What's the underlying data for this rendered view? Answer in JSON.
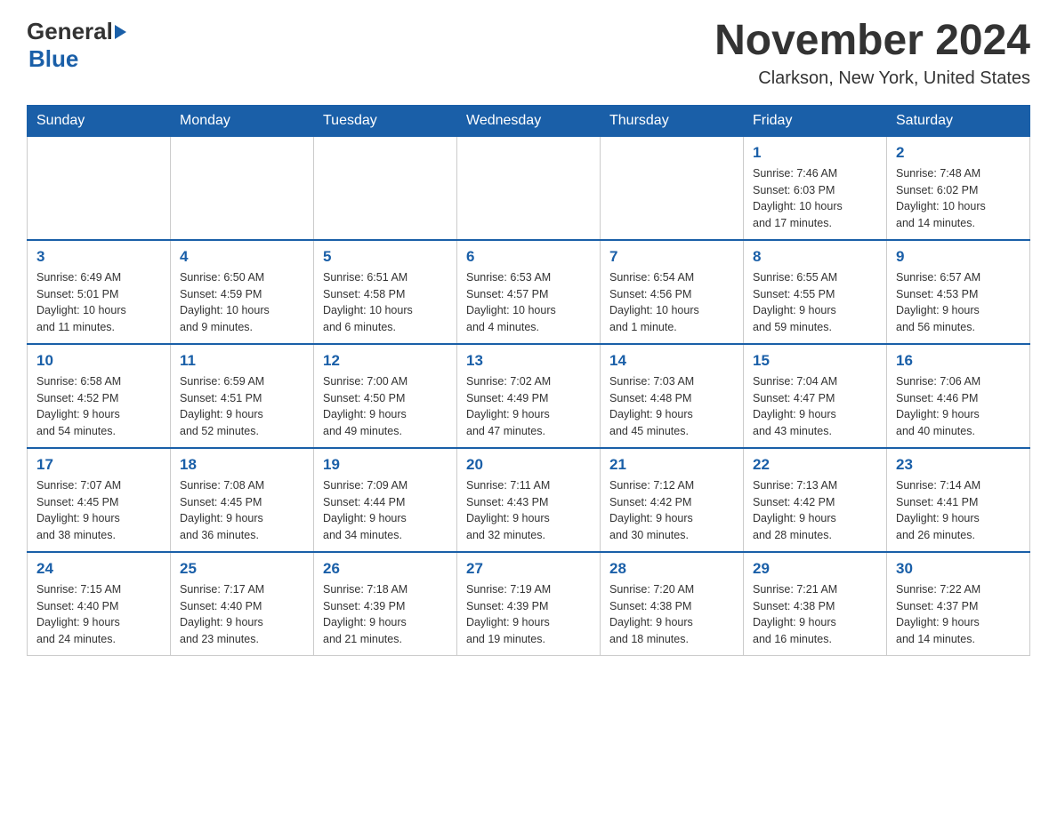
{
  "header": {
    "logo_general": "General",
    "logo_blue": "Blue",
    "title": "November 2024",
    "subtitle": "Clarkson, New York, United States"
  },
  "weekdays": [
    "Sunday",
    "Monday",
    "Tuesday",
    "Wednesday",
    "Thursday",
    "Friday",
    "Saturday"
  ],
  "rows": [
    {
      "cells": [
        {
          "day": "",
          "info": ""
        },
        {
          "day": "",
          "info": ""
        },
        {
          "day": "",
          "info": ""
        },
        {
          "day": "",
          "info": ""
        },
        {
          "day": "",
          "info": ""
        },
        {
          "day": "1",
          "info": "Sunrise: 7:46 AM\nSunset: 6:03 PM\nDaylight: 10 hours\nand 17 minutes."
        },
        {
          "day": "2",
          "info": "Sunrise: 7:48 AM\nSunset: 6:02 PM\nDaylight: 10 hours\nand 14 minutes."
        }
      ]
    },
    {
      "cells": [
        {
          "day": "3",
          "info": "Sunrise: 6:49 AM\nSunset: 5:01 PM\nDaylight: 10 hours\nand 11 minutes."
        },
        {
          "day": "4",
          "info": "Sunrise: 6:50 AM\nSunset: 4:59 PM\nDaylight: 10 hours\nand 9 minutes."
        },
        {
          "day": "5",
          "info": "Sunrise: 6:51 AM\nSunset: 4:58 PM\nDaylight: 10 hours\nand 6 minutes."
        },
        {
          "day": "6",
          "info": "Sunrise: 6:53 AM\nSunset: 4:57 PM\nDaylight: 10 hours\nand 4 minutes."
        },
        {
          "day": "7",
          "info": "Sunrise: 6:54 AM\nSunset: 4:56 PM\nDaylight: 10 hours\nand 1 minute."
        },
        {
          "day": "8",
          "info": "Sunrise: 6:55 AM\nSunset: 4:55 PM\nDaylight: 9 hours\nand 59 minutes."
        },
        {
          "day": "9",
          "info": "Sunrise: 6:57 AM\nSunset: 4:53 PM\nDaylight: 9 hours\nand 56 minutes."
        }
      ]
    },
    {
      "cells": [
        {
          "day": "10",
          "info": "Sunrise: 6:58 AM\nSunset: 4:52 PM\nDaylight: 9 hours\nand 54 minutes."
        },
        {
          "day": "11",
          "info": "Sunrise: 6:59 AM\nSunset: 4:51 PM\nDaylight: 9 hours\nand 52 minutes."
        },
        {
          "day": "12",
          "info": "Sunrise: 7:00 AM\nSunset: 4:50 PM\nDaylight: 9 hours\nand 49 minutes."
        },
        {
          "day": "13",
          "info": "Sunrise: 7:02 AM\nSunset: 4:49 PM\nDaylight: 9 hours\nand 47 minutes."
        },
        {
          "day": "14",
          "info": "Sunrise: 7:03 AM\nSunset: 4:48 PM\nDaylight: 9 hours\nand 45 minutes."
        },
        {
          "day": "15",
          "info": "Sunrise: 7:04 AM\nSunset: 4:47 PM\nDaylight: 9 hours\nand 43 minutes."
        },
        {
          "day": "16",
          "info": "Sunrise: 7:06 AM\nSunset: 4:46 PM\nDaylight: 9 hours\nand 40 minutes."
        }
      ]
    },
    {
      "cells": [
        {
          "day": "17",
          "info": "Sunrise: 7:07 AM\nSunset: 4:45 PM\nDaylight: 9 hours\nand 38 minutes."
        },
        {
          "day": "18",
          "info": "Sunrise: 7:08 AM\nSunset: 4:45 PM\nDaylight: 9 hours\nand 36 minutes."
        },
        {
          "day": "19",
          "info": "Sunrise: 7:09 AM\nSunset: 4:44 PM\nDaylight: 9 hours\nand 34 minutes."
        },
        {
          "day": "20",
          "info": "Sunrise: 7:11 AM\nSunset: 4:43 PM\nDaylight: 9 hours\nand 32 minutes."
        },
        {
          "day": "21",
          "info": "Sunrise: 7:12 AM\nSunset: 4:42 PM\nDaylight: 9 hours\nand 30 minutes."
        },
        {
          "day": "22",
          "info": "Sunrise: 7:13 AM\nSunset: 4:42 PM\nDaylight: 9 hours\nand 28 minutes."
        },
        {
          "day": "23",
          "info": "Sunrise: 7:14 AM\nSunset: 4:41 PM\nDaylight: 9 hours\nand 26 minutes."
        }
      ]
    },
    {
      "cells": [
        {
          "day": "24",
          "info": "Sunrise: 7:15 AM\nSunset: 4:40 PM\nDaylight: 9 hours\nand 24 minutes."
        },
        {
          "day": "25",
          "info": "Sunrise: 7:17 AM\nSunset: 4:40 PM\nDaylight: 9 hours\nand 23 minutes."
        },
        {
          "day": "26",
          "info": "Sunrise: 7:18 AM\nSunset: 4:39 PM\nDaylight: 9 hours\nand 21 minutes."
        },
        {
          "day": "27",
          "info": "Sunrise: 7:19 AM\nSunset: 4:39 PM\nDaylight: 9 hours\nand 19 minutes."
        },
        {
          "day": "28",
          "info": "Sunrise: 7:20 AM\nSunset: 4:38 PM\nDaylight: 9 hours\nand 18 minutes."
        },
        {
          "day": "29",
          "info": "Sunrise: 7:21 AM\nSunset: 4:38 PM\nDaylight: 9 hours\nand 16 minutes."
        },
        {
          "day": "30",
          "info": "Sunrise: 7:22 AM\nSunset: 4:37 PM\nDaylight: 9 hours\nand 14 minutes."
        }
      ]
    }
  ]
}
